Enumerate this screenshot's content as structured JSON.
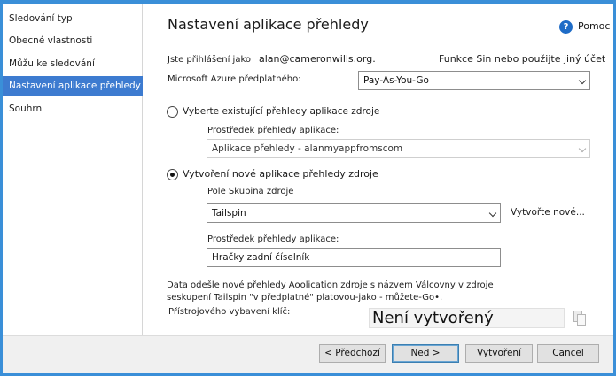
{
  "sidebar": {
    "items": [
      {
        "label": "Sledování typ"
      },
      {
        "label": "Obecné vlastnosti"
      },
      {
        "label": "Můžu ke sledování"
      },
      {
        "label": "Nastavení aplikace přehledy"
      },
      {
        "label": "Souhrn"
      }
    ]
  },
  "header": {
    "title": "Nastavení aplikace přehledy",
    "help_label": "Pomoc"
  },
  "account": {
    "signed_in_label": "Jste přihlášení jako",
    "email": "alan@cameronwills.org.",
    "switch_link": "Funkce Sin nebo použijte jiný účet"
  },
  "subscription": {
    "label": "Microsoft Azure předplatného:",
    "value": "Pay-As-You-Go"
  },
  "existing": {
    "radio_label": "Vyberte existující přehledy aplikace zdroje",
    "resource_label": "Prostředek přehledy aplikace:",
    "resource_value": "Aplikace přehledy - alanmyappfromscom"
  },
  "create_new": {
    "radio_label": "Vytvoření nové aplikace přehledy zdroje",
    "resource_group_label": "Pole Skupina zdroje",
    "resource_group_value": "Tailspin",
    "create_new_link": "Vytvořte nové...",
    "resource_label": "Prostředek přehledy aplikace:",
    "resource_value": "Hračky zadní číselník"
  },
  "info": {
    "line1": "Data odešle nové přehledy Aoolication zdroje s názvem Válcovny v zdroje",
    "line2": "seskupení Tailspin \"v předplatné\" platovou-jako - můžete-Go•."
  },
  "instrumentation": {
    "label": "Přístrojového vybavení klíč:",
    "value": "Není vytvořený"
  },
  "footer": {
    "back": "< Předchozí",
    "next": "Ned >",
    "create": "Vytvoření",
    "cancel": "Cancel"
  }
}
